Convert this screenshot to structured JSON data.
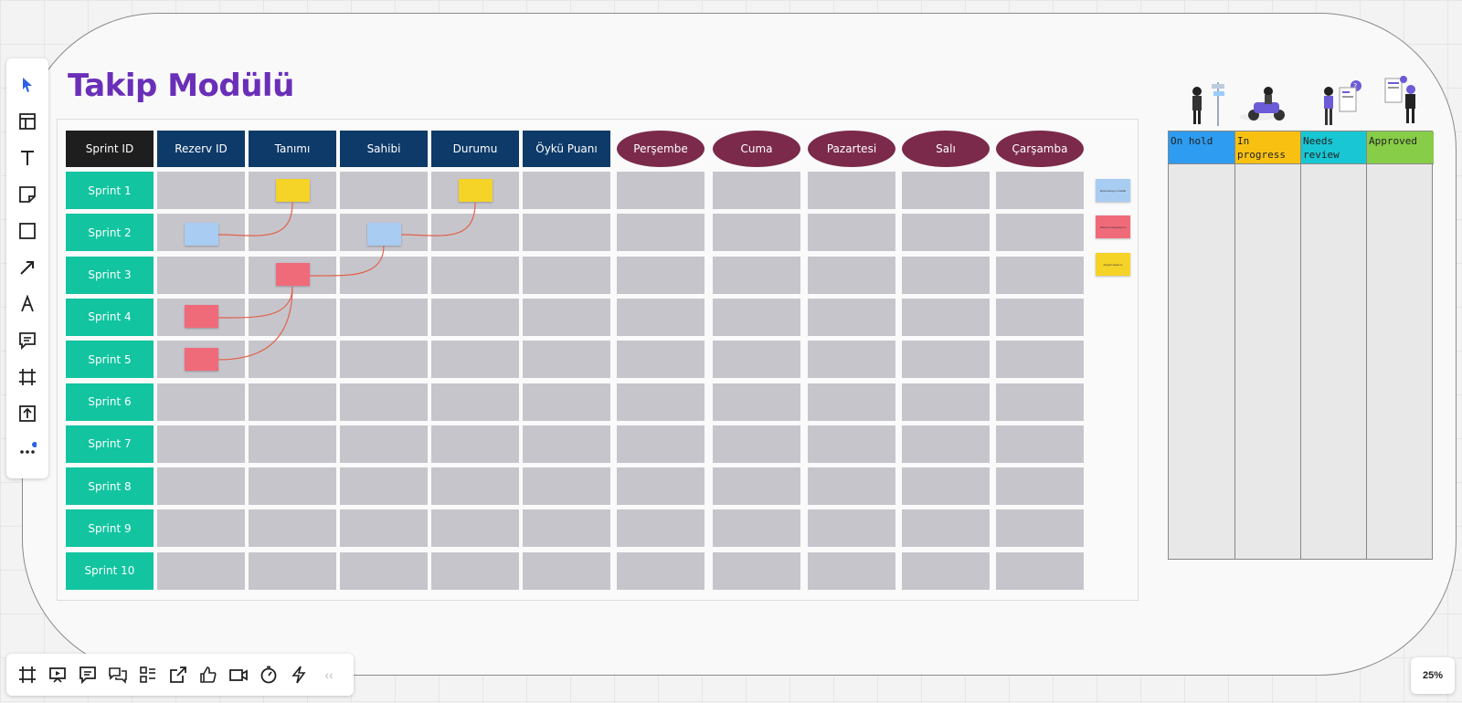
{
  "board": {
    "title": "Takip Modülü",
    "header_row": [
      "Sprint ID",
      "Rezerv ID",
      "Tanımı",
      "Sahibi",
      "Durumu",
      "Öykü Puanı"
    ],
    "day_headers": [
      "Perşembe",
      "Cuma",
      "Pazartesi",
      "Salı",
      "Çarşamba"
    ],
    "rows": [
      "Sprint 1",
      "Sprint 2",
      "Sprint 3",
      "Sprint 4",
      "Sprint 5",
      "Sprint 6",
      "Sprint 7",
      "Sprint 8",
      "Sprint 9",
      "Sprint 10"
    ]
  },
  "legend": {
    "items": [
      {
        "color": "#a9ccf2",
        "label": "Rezervasyon modülü"
      },
      {
        "color": "#f06b7a",
        "label": "Ödeme entegrasyonu"
      },
      {
        "color": "#f5d327",
        "label": "Arayüz tasarımı"
      }
    ]
  },
  "kanban": {
    "columns": [
      {
        "label": "On hold",
        "color": "#2e9cf0"
      },
      {
        "label": "In progress",
        "color": "#f8c112"
      },
      {
        "label": "Needs review",
        "color": "#19c6d3"
      },
      {
        "label": "Approved",
        "color": "#87cd48"
      }
    ]
  },
  "toolbar_left": {
    "tools": [
      "select-icon",
      "templates-icon",
      "text-icon",
      "sticky-note-icon",
      "shape-icon",
      "arrow-icon",
      "pen-icon",
      "comment-icon",
      "frame-icon",
      "upload-icon",
      "more-icon"
    ]
  },
  "toolbar_bottom": {
    "tools": [
      "frame-icon",
      "presentation-icon",
      "comment-icon",
      "chat-icon",
      "cards-icon",
      "share-icon",
      "like-icon",
      "video-icon",
      "timer-icon",
      "lightning-icon",
      "collapse-icon"
    ],
    "collapse_label": "‹‹"
  },
  "zoom": {
    "level": "25%"
  },
  "colors": {
    "title": "#6a2fb8",
    "header_dark": "#0d3a68",
    "header_oval": "#7b2a4c",
    "row_label": "#12c4a0",
    "grid": "#c7c5cc"
  }
}
